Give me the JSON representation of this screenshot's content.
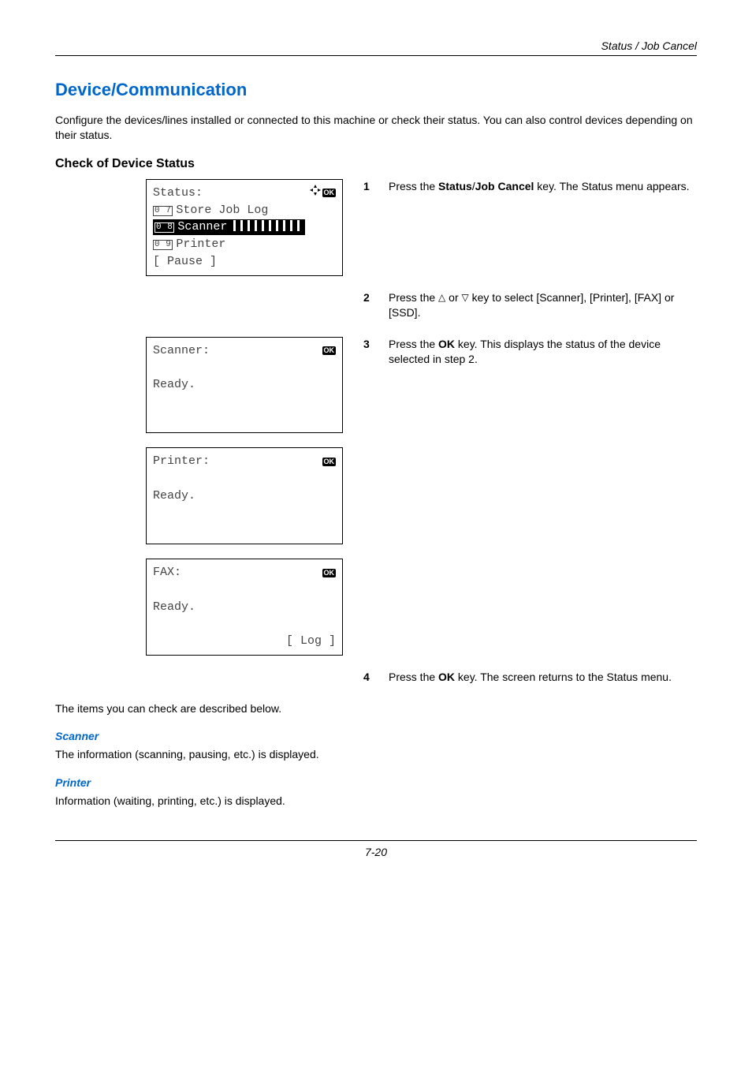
{
  "header": {
    "title": "Status / Job Cancel"
  },
  "section": {
    "h1": "Device/Communication",
    "intro": "Configure the devices/lines installed or connected to this machine or check their status. You can also control devices depending on their status.",
    "h2": "Check of Device Status"
  },
  "lcd1": {
    "title": "Status:",
    "line07_num": "0 7",
    "line07": "Store Job Log",
    "line08_num": "0 8",
    "line08": "Scanner",
    "line09_num": "0 9",
    "line09": "Printer",
    "softkey": "[ Pause  ]"
  },
  "lcd2": {
    "title": "Scanner:",
    "body": "Ready."
  },
  "lcd3": {
    "title": "Printer:",
    "body": "Ready."
  },
  "lcd4": {
    "title": "FAX:",
    "body": "Ready.",
    "softkey": "[  Log   ]"
  },
  "steps": {
    "s1": {
      "num": "1",
      "pre": "Press the ",
      "bold": "Status",
      "slash": "/",
      "bold2": "Job Cancel",
      "post": " key. The Status menu appears."
    },
    "s2": {
      "num": "2",
      "pre": "Press the ",
      "mid": " or ",
      "post": " key to select [Scanner], [Printer], [FAX] or [SSD]."
    },
    "s3": {
      "num": "3",
      "pre": "Press the ",
      "bold": "OK",
      "post": " key. This displays the status of the device selected in step 2."
    },
    "s4": {
      "num": "4",
      "pre": "Press the ",
      "bold": "OK",
      "post": " key. The screen returns to the Status menu."
    }
  },
  "lower": {
    "lead": "The items you can check are described below.",
    "scan_h": "Scanner",
    "scan_p": "The information (scanning, pausing, etc.) is displayed.",
    "prn_h": "Printer",
    "prn_p": "Information (waiting, printing, etc.) is displayed."
  },
  "footer": {
    "page": "7-20"
  },
  "ok_label": "OK"
}
